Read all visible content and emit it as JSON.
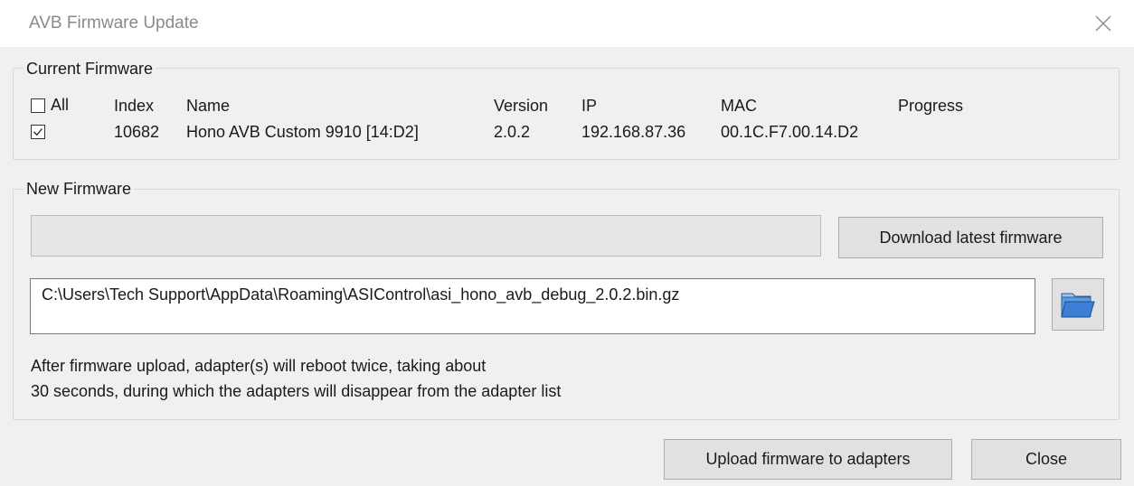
{
  "window": {
    "title": "AVB Firmware Update",
    "close_icon": "close-icon"
  },
  "current_firmware": {
    "legend": "Current Firmware",
    "all_label": "All",
    "all_checked": false,
    "columns": {
      "index": "Index",
      "name": "Name",
      "version": "Version",
      "ip": "IP",
      "mac": "MAC",
      "progress": "Progress"
    },
    "rows": [
      {
        "checked": true,
        "index": "10682",
        "name": "Hono AVB Custom 9910 [14:D2]",
        "version": "2.0.2",
        "ip": "192.168.87.36",
        "mac": "00.1C.F7.00.14.D2",
        "progress": ""
      }
    ]
  },
  "new_firmware": {
    "legend": "New Firmware",
    "download_progress": 0,
    "download_button": "Download latest firmware",
    "file_path": "C:\\Users\\Tech Support\\AppData\\Roaming\\ASIControl\\asi_hono_avb_debug_2.0.2.bin.gz",
    "browse_icon": "folder-open-icon",
    "note_line1": "After firmware upload, adapter(s) will reboot twice, taking about",
    "note_line2": "30 seconds, during which the adapters will disappear from the adapter list"
  },
  "buttons": {
    "upload": "Upload firmware to adapters",
    "close": "Close"
  },
  "colors": {
    "window_bg": "#f0f0f0",
    "title_text": "#8a8a8a",
    "folder_blue": "#3d7fd4"
  }
}
